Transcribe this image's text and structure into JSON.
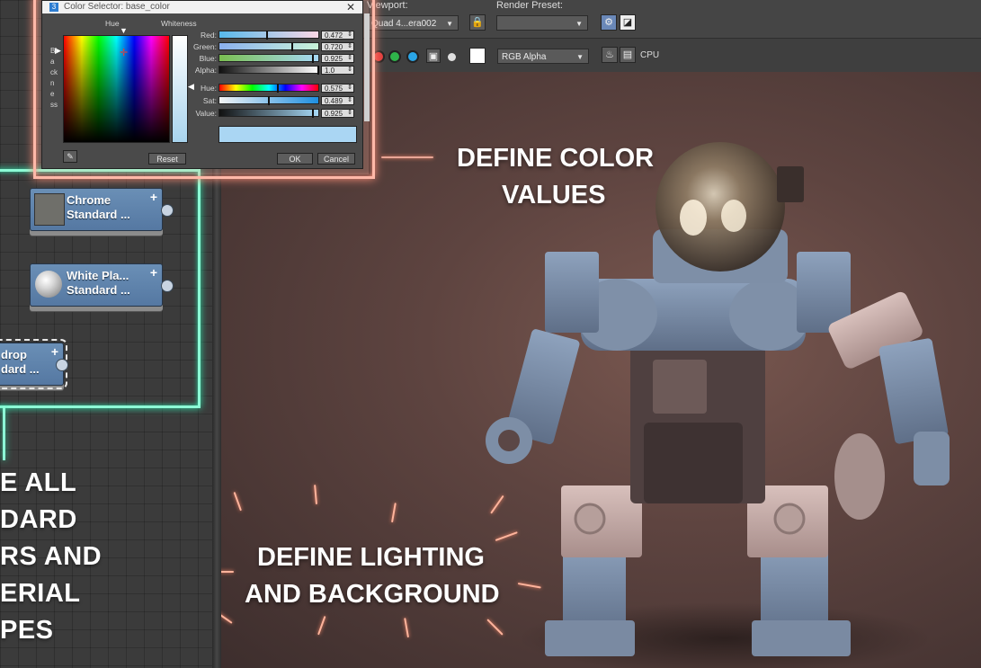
{
  "topbar": {
    "viewport_label": "Viewport:",
    "viewport_value": "Quad 4...era002",
    "render_preset_label": "Render Preset:",
    "render_preset_value": "",
    "channel_value": "RGB Alpha",
    "cpu_label": "CPU",
    "icons": [
      "lock-icon",
      "render-setup-icon",
      "toggle-icon",
      "red-channel",
      "green-channel",
      "blue-channel",
      "mono-icon",
      "white-swatch",
      "teapot-icon",
      "frame-icon"
    ],
    "colors": {
      "red": "#e23c3c",
      "green": "#2fb34a",
      "blue": "#2aa5e6"
    }
  },
  "dialog": {
    "title": "Color Selector: base_color",
    "hue_label": "Hue",
    "whiteness_label": "Whiteness",
    "blackness_label": "Blackness",
    "rows": [
      {
        "label": "Red:",
        "value": "0.472"
      },
      {
        "label": "Green:",
        "value": "0.720"
      },
      {
        "label": "Blue:",
        "value": "0.925"
      },
      {
        "label": "Alpha:",
        "value": "1.0"
      },
      {
        "label": "Hue:",
        "value": "0.575"
      },
      {
        "label": "Sat:",
        "value": "0.489"
      },
      {
        "label": "Value:",
        "value": "0.925"
      }
    ],
    "reset_label": "Reset",
    "ok_label": "OK",
    "cancel_label": "Cancel",
    "preview_color": "#aad6f3"
  },
  "nodes": [
    {
      "line1": "Chrome",
      "line2": "Standard ..."
    },
    {
      "line1": "White Pla...",
      "line2": "Standard ..."
    },
    {
      "line1": "drop",
      "line2": "dard ..."
    }
  ],
  "left_callout": [
    "E ALL",
    "DARD",
    "RS AND",
    "ERIAL",
    "PES"
  ],
  "callouts": {
    "color_line1": "DEFINE COLOR",
    "color_line2": "VALUES",
    "lighting_line1": "DEFINE LIGHTING",
    "lighting_line2": "AND BACKGROUND"
  },
  "accent": {
    "neon_green": "#8dfcd6",
    "salmon": "#ffb8a8"
  }
}
